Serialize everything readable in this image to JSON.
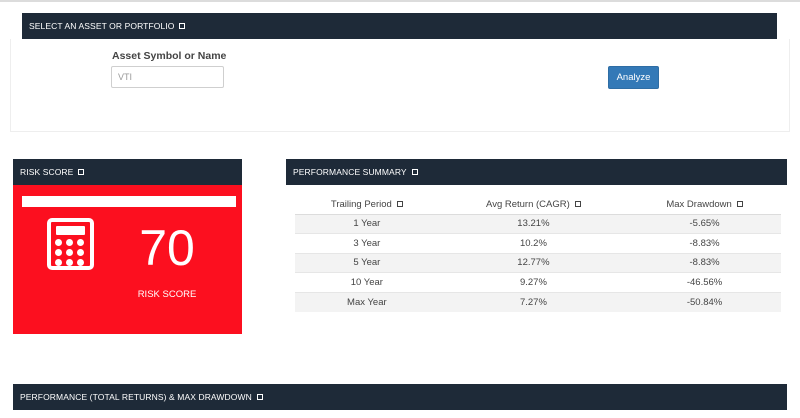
{
  "asset_section": {
    "title": "SELECT AN ASSET OR PORTFOLIO",
    "field_label": "Asset Symbol or Name",
    "input_value": "VTI",
    "button_label": "Analyze"
  },
  "risk_section": {
    "title": "RISK SCORE",
    "score": "70",
    "score_label": "RISK SCORE",
    "icon": "calculator-icon",
    "color": "#fc0f1f"
  },
  "performance_summary": {
    "title": "PERFORMANCE SUMMARY",
    "columns": [
      "Trailing Period",
      "Avg Return (CAGR)",
      "Max Drawdown"
    ],
    "rows": [
      [
        "1 Year",
        "13.21%",
        "-5.65%"
      ],
      [
        "3 Year",
        "10.2%",
        "-8.83%"
      ],
      [
        "5 Year",
        "12.77%",
        "-8.83%"
      ],
      [
        "10 Year",
        "9.27%",
        "-46.56%"
      ],
      [
        "Max Year",
        "7.27%",
        "-50.84%"
      ]
    ]
  },
  "chart_section": {
    "title": "PERFORMANCE (TOTAL RETURNS) & MAX DRAWDOWN"
  },
  "colors": {
    "header_bar": "#1e2a38",
    "button": "#3379b7"
  }
}
